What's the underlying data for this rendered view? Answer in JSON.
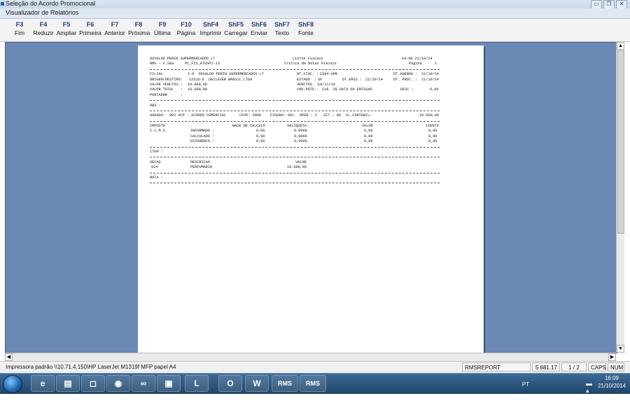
{
  "window": {
    "outer_title": "Seleção do Acordo Promocional",
    "inner_title": "Visualizador de Relatórios",
    "controls": [
      "▭",
      "❐",
      "✕"
    ]
  },
  "toolbar": [
    {
      "key": "F3",
      "label": "Fim"
    },
    {
      "key": "F4",
      "label": "Reduzir"
    },
    {
      "key": "F5",
      "label": "Ampliar"
    },
    {
      "key": "F6",
      "label": "Primeira"
    },
    {
      "key": "F7",
      "label": "Anterior"
    },
    {
      "key": "F8",
      "label": "Próxima"
    },
    {
      "key": "F9",
      "label": "Última"
    },
    {
      "key": "F10",
      "label": "Página"
    },
    {
      "key": "ShF4",
      "label": "Imprimir"
    },
    {
      "key": "ShF5",
      "label": "Carregar"
    },
    {
      "key": "ShF6",
      "label": "Enviar"
    },
    {
      "key": "ShF7",
      "label": "Texto"
    },
    {
      "key": "ShF8",
      "label": "Fonte"
    }
  ],
  "report": {
    "company": "OSVALDO PERIN SUPERMERCADOS LT",
    "book": "Livros Fiscais",
    "time_date": "04:09 21/10/14",
    "system": "RMS - v.S0a",
    "program": "PC_FIS_ATUSP1-13",
    "subtitle": "Critica de Notas Fiscais",
    "page_label": "Pagina",
    "page_num": "1",
    "filial_label": "FILIAL",
    "filial_value": "1-9  OSVALDO PERIN SUPERMERCADOS LT",
    "nf_label": "NT.FISC. :",
    "nf_value": "1584-APR",
    "dt_agenda_label": "DT.AGENDA :",
    "dt_agenda": "21/10/14",
    "origem_label": "ORIGEM/DESTINO:",
    "origem_value": "12516-6  UNILEVER BRASIL LTDA",
    "estado_label": "ESTADO  :",
    "estado_value": "SP",
    "dt_emis_label": "DT.EMIS.:",
    "dt_emis": "21/10/14",
    "dt_proc_label": "DT. PROC. :",
    "dt_proc": "21/10/14",
    "vencto_label": "VALOR VENCTOS.:",
    "vencto_value": "10.000,00",
    "venctos_label": "VENCTOS. :",
    "venctos_value": "18/11/14",
    "total_label": "VALOR TOTAL   :",
    "total_value": "10.000,00",
    "cnd_label": "CND.PGTO.:",
    "cnd_value": "128  28 DATA DO EMISSAO",
    "desc_label": "DESC :",
    "desc_value": "0,00",
    "portador_label": "PORTADOR      :",
    "obs_label": "OBS.:",
    "agenda_line": "AGENDA:  882 ACP - ACORDO COMERCIAL",
    "cfop": "CFOP: 5900",
    "figura": "FIGURA: 001",
    "oper": "OPER.: 2",
    "sit": "SIT.: 90",
    "vl_contabil_label": "VL.CONTABIL:",
    "vl_contabil": "10.000,00",
    "tax_headers": [
      "IMPOSTO",
      "BASE DE CALCULO",
      "%ALIQUOTA",
      "VALOR",
      "ISENTO"
    ],
    "tax_name": "I.C.M.S.",
    "tax_rows": [
      {
        "label": "INFORMADO :",
        "base": "0,00",
        "aliq": "0,0000",
        "valor": "0,00",
        "isento": "0,00"
      },
      {
        "label": "CALCULADO :",
        "base": "0,00",
        "aliq": "0,0000",
        "valor": "0,00",
        "isento": "0,00"
      },
      {
        "label": "DIFERENCA :",
        "base": "0,00",
        "aliq": "0,0000",
        "valor": "0,00",
        "isento": "0,00"
      }
    ],
    "item_label": "ITEM :",
    "item_headers": [
      "SECAO",
      "DESCRICAO",
      "VALOR"
    ],
    "item_secao": "014",
    "item_desc": "PERFUMARIA",
    "item_valor": "10.000,00",
    "nota_label": "NOTA :"
  },
  "status": {
    "printer": "Impressora padrão \\\\10.71.4.150\\HP LaserJet M1319f MFP papel A4",
    "report_name": "RMSREPORT",
    "value": "5.681.17",
    "pages": "1 / 2",
    "caps": "CAPS",
    "num": "NUM"
  },
  "taskbar": {
    "apps": [
      "e",
      "▤",
      "◻",
      "◉",
      "∞",
      "▣",
      "L",
      "O",
      "W",
      "RMS",
      "RMS"
    ],
    "lang": "PT",
    "tray_icons": "▬ ▴ ⚑ ▭ ◖",
    "time": "16:09",
    "date": "21/10/2014"
  }
}
